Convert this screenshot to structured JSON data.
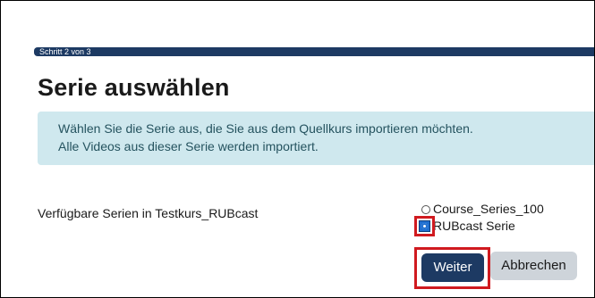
{
  "progress": {
    "label": "Schritt 2 von 3"
  },
  "page": {
    "title": "Serie auswählen"
  },
  "info": {
    "line1": "Wählen Sie die Serie aus, die Sie aus dem Quellkurs importieren möchten.",
    "line2": "Alle Videos aus dieser Serie werden importiert."
  },
  "form": {
    "label": "Verfügbare Serien in Testkurs_RUBcast",
    "options": [
      {
        "label": "Course_Series_100",
        "checked": false
      },
      {
        "label": "RUBcast Serie",
        "checked": true
      }
    ]
  },
  "buttons": {
    "continue_label": "Weiter",
    "cancel_label": "Abbrechen"
  },
  "colors": {
    "primary": "#1d3a63",
    "info_background": "#cfe8ee",
    "highlight": "#d01a1f",
    "secondary_button": "#ced4da"
  }
}
